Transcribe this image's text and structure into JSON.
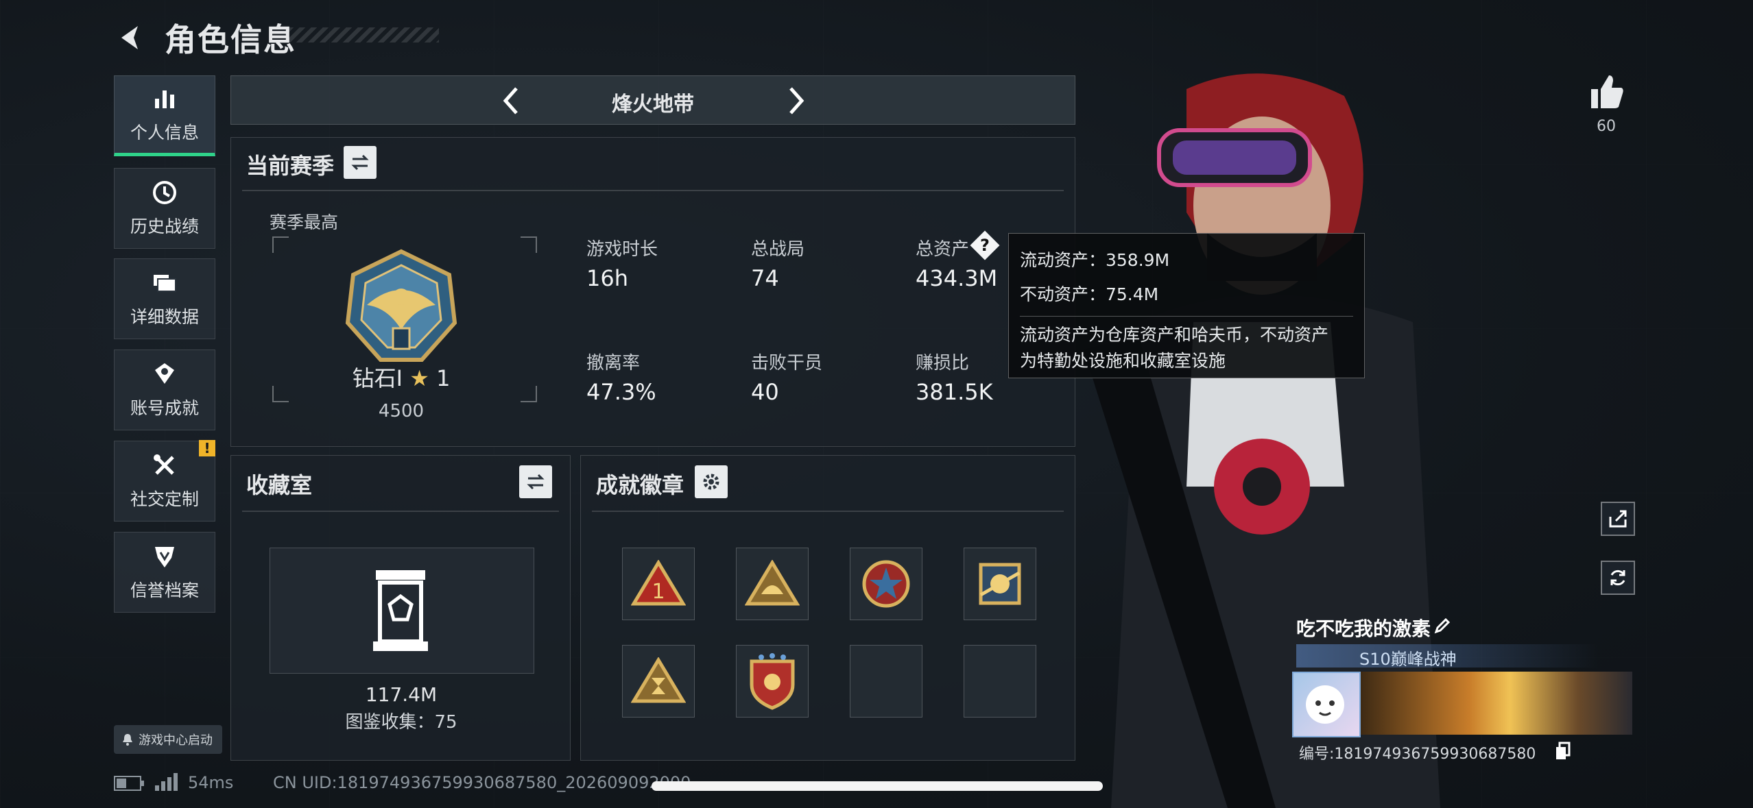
{
  "header": {
    "title": "角色信息"
  },
  "sidebar": {
    "items": [
      {
        "label": "个人信息"
      },
      {
        "label": "历史战绩"
      },
      {
        "label": "详细数据"
      },
      {
        "label": "账号成就"
      },
      {
        "label": "社交定制"
      },
      {
        "label": "信誉档案"
      }
    ],
    "alert_badge": "!",
    "launch_label": "游戏中心启动"
  },
  "mode": {
    "name": "烽火地带"
  },
  "season": {
    "title": "当前赛季",
    "best_label": "赛季最高",
    "rank": "钻石I",
    "rank_stars": "1",
    "rank_points": "4500",
    "stats": [
      {
        "label": "游戏时长",
        "value": "16h"
      },
      {
        "label": "总战局",
        "value": "74"
      },
      {
        "label": "总资产",
        "value": "434.3M"
      },
      {
        "label": "撤离率",
        "value": "47.3%"
      },
      {
        "label": "击败干员",
        "value": "40"
      },
      {
        "label": "赚损比",
        "value": "381.5K"
      }
    ]
  },
  "tooltip": {
    "liquid": "流动资产：358.9M",
    "fixed": "不动资产：75.4M",
    "desc_line1": "流动资产为仓库资产和哈夫币，不动资产",
    "desc_line2": "为特勤处设施和收藏室设施"
  },
  "collection": {
    "title": "收藏室",
    "value": "117.4M",
    "catalog": "图鉴收集：75"
  },
  "achievements": {
    "title": "成就徽章"
  },
  "profile": {
    "likes": "60",
    "name": "吃不吃我的激素",
    "title_badge": "S10巅峰战神",
    "id_line": "编号:18197493675993068758​0"
  },
  "footer": {
    "ping": "54ms",
    "uid": "CN UID:18197493675993068758​0_20260909​2000"
  },
  "colors": {
    "accent": "#2fd38a",
    "alert": "#f0b429"
  }
}
